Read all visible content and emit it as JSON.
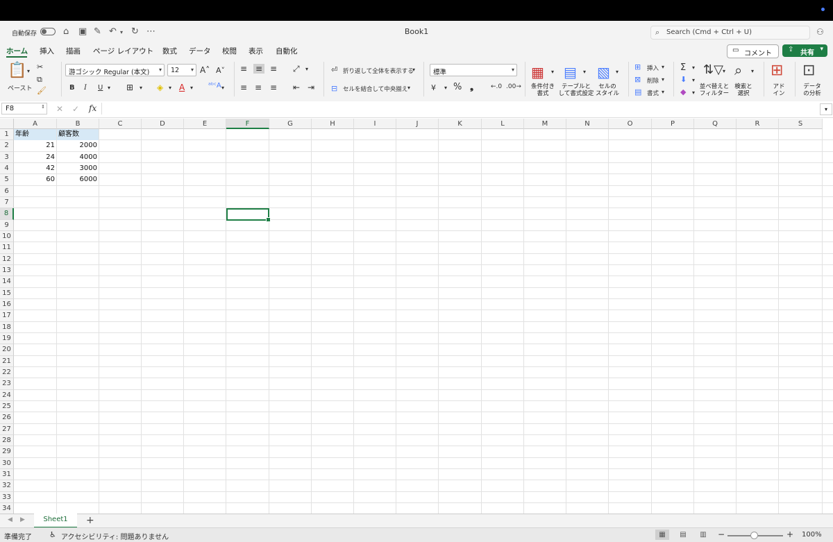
{
  "window": {
    "title": "Book1",
    "autosave_label": "自動保存",
    "search_placeholder": "Search (Cmd + Ctrl + U)"
  },
  "tabs": [
    "ホーム",
    "挿入",
    "描画",
    "ページ レイアウト",
    "数式",
    "データ",
    "校閲",
    "表示",
    "自動化"
  ],
  "active_tab": "ホーム",
  "actions": {
    "comment": "コメント",
    "share": "共有"
  },
  "ribbon": {
    "paste": "ペースト",
    "font_name": "游ゴシック Regular (本文)",
    "font_size": "12",
    "bold": "B",
    "italic": "I",
    "underline": "U",
    "wrap_text": "折り返して全体を表示する",
    "merge_center": "セルを結合して中央揃え",
    "number_format": "標準",
    "percent": "%",
    "comma": "❟",
    "conditional_format": [
      "条件付き",
      "書式"
    ],
    "format_as_table": [
      "テーブルと",
      "して書式設定"
    ],
    "cell_styles": [
      "セルの",
      "スタイル"
    ],
    "insert": "挿入",
    "delete": "削除",
    "format": "書式",
    "sort_filter": [
      "並べ替えと",
      "フィルター"
    ],
    "find_select": [
      "検索と",
      "選択"
    ],
    "addins": [
      "アド",
      "イン"
    ],
    "analyze": [
      "データ",
      "の分析"
    ]
  },
  "formula_bar": {
    "name_box": "F8",
    "fx": "fx",
    "value": ""
  },
  "columns": [
    "A",
    "B",
    "C",
    "D",
    "E",
    "F",
    "G",
    "H",
    "I",
    "J",
    "K",
    "L",
    "M",
    "N",
    "O",
    "P",
    "Q",
    "R",
    "S"
  ],
  "selected_column": "F",
  "rows": [
    "1",
    "2",
    "3",
    "4",
    "5",
    "6",
    "7",
    "8",
    "9",
    "10",
    "11",
    "12",
    "13",
    "14",
    "15",
    "16",
    "17",
    "18",
    "19",
    "20",
    "21",
    "22",
    "23",
    "24",
    "25",
    "26",
    "27",
    "28",
    "29",
    "30",
    "31",
    "32",
    "33",
    "34"
  ],
  "selected_row": "8",
  "cells": {
    "A1": "年齢",
    "B1": "顧客数",
    "A2": "21",
    "B2": "2000",
    "A3": "24",
    "B3": "4000",
    "A4": "42",
    "B4": "3000",
    "A5": "60",
    "B5": "6000"
  },
  "sheet": {
    "name": "Sheet1",
    "add": "+"
  },
  "status": {
    "ready": "準備完了",
    "accessibility": "アクセシビリティ: 問題ありません",
    "zoom": "100%"
  }
}
